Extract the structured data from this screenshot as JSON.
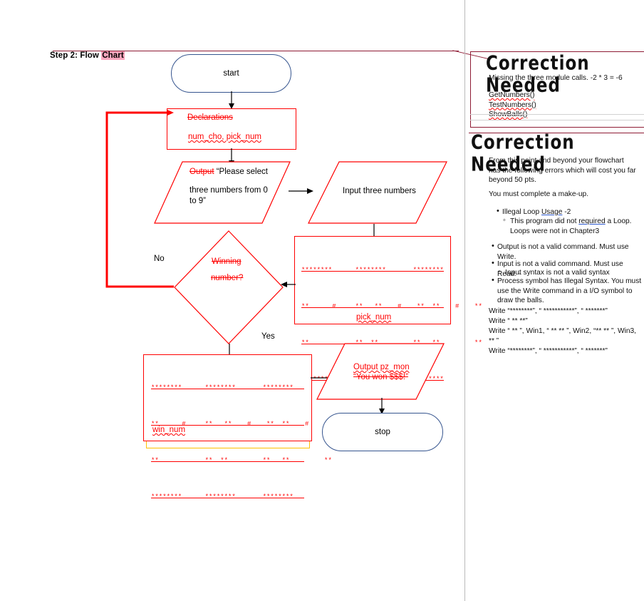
{
  "document": {
    "step_label_prefix": "Step 2:  Flow ",
    "step_label_highlight": "Chart"
  },
  "flowchart": {
    "start": "start",
    "stop": "stop",
    "declarations": {
      "title": "Declarations",
      "vars": "num_cho, pick_num"
    },
    "output_prompt": {
      "keyword": "Output",
      "line1": " “Please select",
      "line2": "three numbers from 0",
      "line3": "to 9”"
    },
    "input_box": "Input three numbers",
    "decision": {
      "line1": "Winning",
      "line2": "number?"
    },
    "label_no": "No",
    "label_yes": "Yes",
    "pick_process": {
      "art_rows": [
        "********      ********       ********",
        "**      #     **   **    #    **  **    #    **",
        "**            **  **         **   **         **",
        "********      ********       ********"
      ],
      "caption": "pick_num"
    },
    "win_process": {
      "art_rows": [
        "********      ********       ********",
        "**      #     **   **    #    **  **    #    **",
        "**            **  **         **   **         **",
        "********      ********       ********"
      ],
      "caption": "win_num"
    },
    "output_win": {
      "line1_keyword": "Output pz_mon",
      "line2": "“You won $$$!”"
    }
  },
  "annotations": {
    "block1": {
      "heading": "Correction Needed",
      "line1": "Missing the three module calls.   -2 * 3 = -6",
      "calls": [
        "GetNumbers()",
        "TestNumbers()",
        "ShowBalls()"
      ]
    },
    "block2": {
      "heading": "Correction Needed",
      "para1": "From this point and beyond your flowchart has the following errors which will cost you far beyond 50 pts.",
      "para2": "You must complete a make-up.",
      "bullets": [
        {
          "text_a": "Illegal Loop ",
          "text_b": "Usage",
          "text_c": "  -2",
          "sub": {
            "a": "This program did not ",
            "b": "required",
            "c": " a Loop.  Loops were not in Chapter3"
          }
        },
        {
          "text": "Output is not a valid command.  Must use Write."
        },
        {
          "text": "Input is not a valid command. Must use Read.  -",
          "sub_plain": "Input syntax is not a valid syntax"
        },
        {
          "text": "Process symbol has Illegal Syntax.  You must use the Write command in a I/O symbol to draw the balls."
        }
      ],
      "write_lines": [
        "Write “********”, “   ***********”, “   *******”",
        "Write “ **                                            **”",
        "Write “ **  ”, Win1, “ **    **  ”, Win2, “**   **     ”, Win3,  ** ”",
        "Write “********”, “   ***********”, “   *******”"
      ]
    }
  },
  "colors": {
    "red": "#ff0000",
    "maroon": "#8e1b34",
    "blue": "#36558f",
    "yellow": "#ffc000",
    "highlight_pink": "#f9a6bd"
  }
}
